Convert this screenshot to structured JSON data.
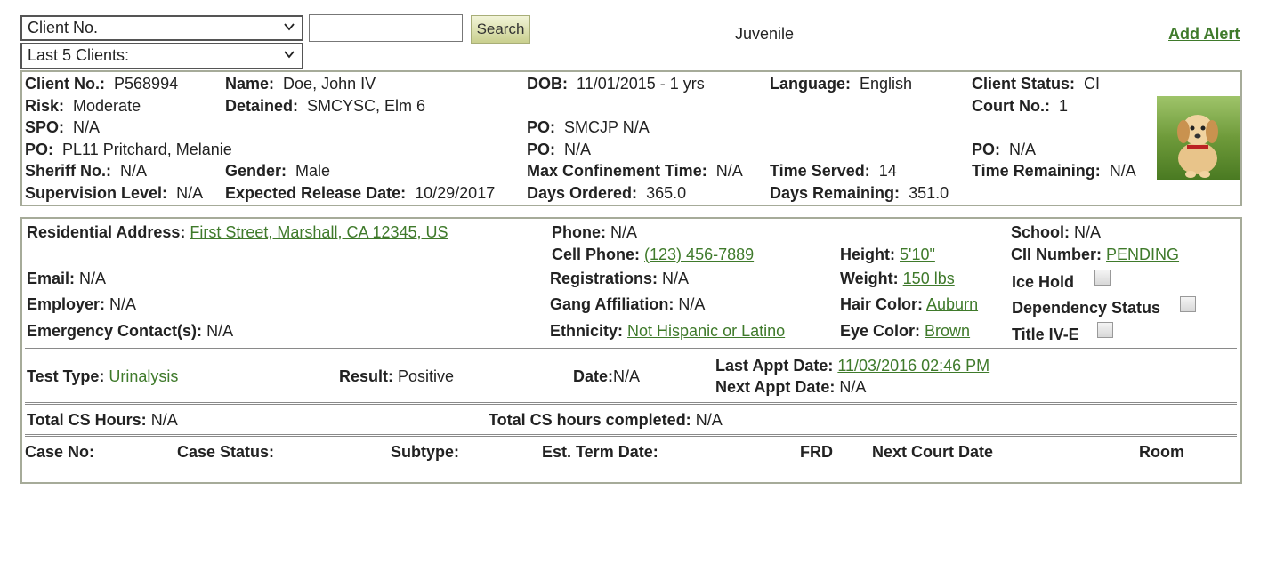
{
  "toolbar": {
    "client_select": "Client No.",
    "search_placeholder": "",
    "search_label": "Search",
    "last_clients_select": "Last 5 Clients:",
    "category": "Juvenile",
    "add_alert": "Add Alert"
  },
  "header": {
    "client_no_label": "Client No.:",
    "client_no": "P568994",
    "name_label": "Name:",
    "name": "Doe, John IV",
    "dob_label": "DOB:",
    "dob": "11/01/2015 - 1 yrs",
    "language_label": "Language:",
    "language": "English",
    "status_label": "Client Status:",
    "status": "CI",
    "risk_label": "Risk:",
    "risk": "Moderate",
    "detained_label": "Detained:",
    "detained": "SMCYSC, Elm 6",
    "court_no_label": "Court No.:",
    "court_no": "1",
    "spo_label": "SPO:",
    "spo": "N/A",
    "po1_label": "PO:",
    "po1": "SMCJP N/A",
    "po2_label": "PO:",
    "po2": "PL11 Pritchard, Melanie",
    "po3_label": "PO:",
    "po3": "N/A",
    "po4_label": "PO:",
    "po4": "N/A",
    "sheriff_label": "Sheriff No.:",
    "sheriff": "N/A",
    "gender_label": "Gender:",
    "gender": "Male",
    "max_conf_label": "Max Confinement Time:",
    "max_conf": "N/A",
    "time_served_label": "Time Served:",
    "time_served": "14",
    "time_remaining_label": "Time Remaining:",
    "time_remaining": "N/A",
    "supervision_label": "Supervision Level:",
    "supervision": "N/A",
    "release_label": "Expected Release Date:",
    "release": "10/29/2017",
    "days_ordered_label": "Days Ordered:",
    "days_ordered": "365.0",
    "days_remaining_label": "Days Remaining:",
    "days_remaining": "351.0"
  },
  "details": {
    "address_label": "Residential Address:",
    "address": "First Street, Marshall, CA 12345, US",
    "phone_label": "Phone:",
    "phone": "N/A",
    "school_label": "School:",
    "school": "N/A",
    "cell_label": "Cell Phone:",
    "cell": "(123) 456-7889",
    "height_label": "Height:",
    "height": "5'10\"",
    "cii_label": "CII Number:",
    "cii": "PENDING",
    "email_label": "Email:",
    "email": "N/A",
    "registrations_label": "Registrations:",
    "registrations": "N/A",
    "weight_label": "Weight:",
    "weight": "150 lbs",
    "ice_hold_label": "Ice Hold",
    "employer_label": "Employer:",
    "employer": "N/A",
    "gang_label": "Gang Affiliation:",
    "gang": "N/A",
    "hair_label": "Hair Color:",
    "hair": "Auburn",
    "dependency_label": "Dependency Status",
    "emergency_label": "Emergency Contact(s):",
    "emergency": "N/A",
    "ethnicity_label": "Ethnicity:",
    "ethnicity": "Not Hispanic or Latino",
    "eye_label": "Eye Color:",
    "eye": "Brown",
    "title4e_label": "Title IV-E"
  },
  "tests": {
    "type_label": "Test Type:",
    "type": "Urinalysis",
    "result_label": "Result:",
    "result": "Positive",
    "date_label": "Date:",
    "date": "N/A",
    "last_appt_label": "Last Appt Date:",
    "last_appt": "11/03/2016 02:46 PM",
    "next_appt_label": "Next Appt Date:",
    "next_appt": "N/A"
  },
  "cs": {
    "total_label": "Total CS Hours:",
    "total": "N/A",
    "completed_label": "Total CS hours completed:",
    "completed": "N/A"
  },
  "cases": {
    "columns": [
      "Case No:",
      "Case Status:",
      "Subtype:",
      "Est. Term Date:",
      "FRD",
      "Next Court Date",
      "Room"
    ]
  }
}
